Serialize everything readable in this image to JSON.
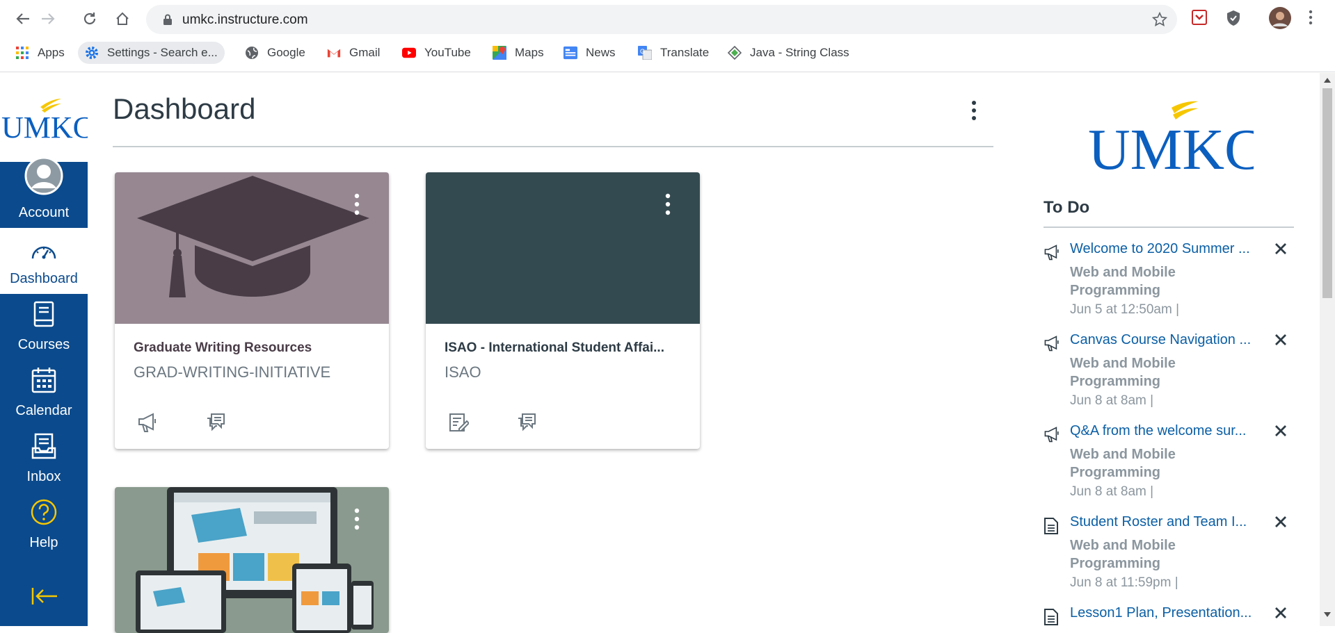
{
  "browser": {
    "url": "umkc.instructure.com",
    "bookmarks": [
      {
        "label": "Apps",
        "icon": "apps-grid-icon"
      },
      {
        "label": "Settings - Search e...",
        "icon": "settings-gear-icon"
      },
      {
        "label": "Google",
        "icon": "globe-icon"
      },
      {
        "label": "Gmail",
        "icon": "gmail-icon"
      },
      {
        "label": "YouTube",
        "icon": "youtube-icon"
      },
      {
        "label": "Maps",
        "icon": "maps-icon"
      },
      {
        "label": "News",
        "icon": "news-icon"
      },
      {
        "label": "Translate",
        "icon": "translate-icon"
      },
      {
        "label": "Java - String Class",
        "icon": "java-site-icon"
      }
    ]
  },
  "logo_text": "UMKC",
  "nav": {
    "account": "Account",
    "dashboard": "Dashboard",
    "courses": "Courses",
    "calendar": "Calendar",
    "inbox": "Inbox",
    "help": "Help"
  },
  "main": {
    "title": "Dashboard",
    "cards": [
      {
        "name": "Graduate Writing Resources",
        "code": "GRAD-WRITING-INITIATIVE",
        "hero_color": "#968791"
      },
      {
        "name": "ISAO - International Student Affai...",
        "code": "ISAO",
        "hero_color": "#334a50"
      },
      {
        "name": "",
        "code": "",
        "hero_color": "#8a9a8e"
      }
    ]
  },
  "sidebar": {
    "todo_heading": "To Do",
    "items": [
      {
        "icon": "announcement-icon",
        "title": "Welcome to 2020 Summer ...",
        "course": "Web and Mobile Programming",
        "date": "Jun 5 at 12:50am  |"
      },
      {
        "icon": "announcement-icon",
        "title": "Canvas Course Navigation ...",
        "course": "Web and Mobile Programming",
        "date": "Jun 8 at 8am  |"
      },
      {
        "icon": "announcement-icon",
        "title": "Q&A from the welcome sur...",
        "course": "Web and Mobile Programming",
        "date": "Jun 8 at 8am  |"
      },
      {
        "icon": "document-icon",
        "title": "Student Roster and Team I...",
        "course": "Web and Mobile Programming",
        "date": "Jun 8 at 11:59pm  |"
      },
      {
        "icon": "document-icon",
        "title": "Lesson1 Plan, Presentation...",
        "course": "",
        "date": ""
      }
    ]
  },
  "colors": {
    "brand": "#0b4a8c",
    "link": "#0b5fa5",
    "logo_gold": "#f6c700"
  }
}
